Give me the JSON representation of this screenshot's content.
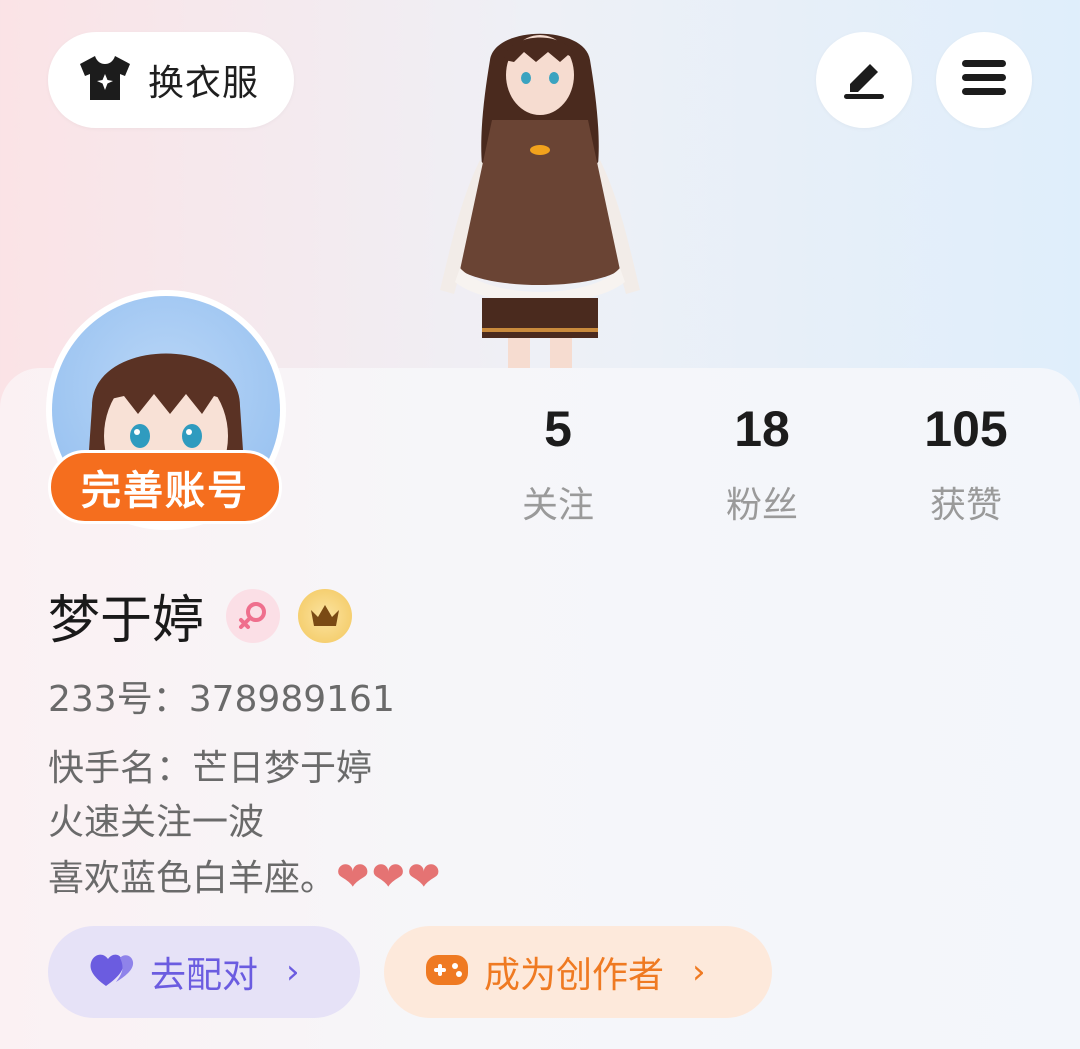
{
  "header": {
    "dress_up_label": "换衣服",
    "icons": {
      "dress_up": "tshirt-star-icon",
      "edit": "pen-icon",
      "menu": "hamburger-menu-icon"
    }
  },
  "profile": {
    "complete_account_label": "完善账号",
    "name": "梦于婷",
    "gender_icon": "female-icon",
    "crown_icon": "crown-icon",
    "uid_text": "233号：378989161",
    "bio": [
      "快手名：芒日梦于婷",
      "火速关注一波",
      "喜欢蓝色白羊座。"
    ],
    "bio_hearts": "❤❤❤"
  },
  "stats": [
    {
      "value": "5",
      "label": "关注"
    },
    {
      "value": "18",
      "label": "粉丝"
    },
    {
      "value": "105",
      "label": "获赞"
    }
  ],
  "actions": {
    "match_label": "去配对",
    "match_icon": "heart-icon",
    "creator_label": "成为创作者",
    "creator_icon": "gamepad-icon",
    "chevron": "›"
  },
  "colors": {
    "accent_orange": "#f56e1e",
    "match_purple": "#6b5ce0",
    "creator_orange": "#ef7a22"
  }
}
